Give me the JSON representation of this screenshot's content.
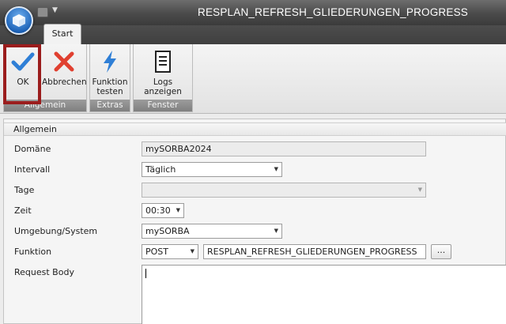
{
  "window": {
    "title": "RESPLAN_REFRESH_GLIEDERUNGEN_PROGRESS"
  },
  "tabs": [
    {
      "label": "Start"
    }
  ],
  "ribbon": {
    "groups": [
      {
        "label": "Allgemein",
        "buttons": [
          {
            "label": "OK",
            "icon": "checkmark-icon"
          },
          {
            "label": "Abbrechen",
            "icon": "cross-icon"
          }
        ]
      },
      {
        "label": "Extras",
        "buttons": [
          {
            "label": "Funktion testen",
            "icon": "lightning-icon"
          }
        ]
      },
      {
        "label": "Fenster",
        "buttons": [
          {
            "label": "Logs anzeigen",
            "icon": "document-icon"
          }
        ]
      }
    ]
  },
  "form": {
    "section_title": "Allgemein",
    "domain": {
      "label": "Domäne",
      "value": "mySORBA2024"
    },
    "interval": {
      "label": "Intervall",
      "value": "Täglich"
    },
    "days": {
      "label": "Tage",
      "value": ""
    },
    "time": {
      "label": "Zeit",
      "value": "00:30"
    },
    "environment": {
      "label": "Umgebung/System",
      "value": "mySORBA"
    },
    "function": {
      "label": "Funktion",
      "method": "POST",
      "value": "RESPLAN_REFRESH_GLIEDERUNGEN_PROGRESS",
      "browse_label": "..."
    },
    "request_body": {
      "label": "Request Body",
      "value": ""
    }
  },
  "colors": {
    "accent_blue": "#2f7fd6",
    "cancel_red": "#e04030",
    "highlight": "#9b1d1d"
  }
}
